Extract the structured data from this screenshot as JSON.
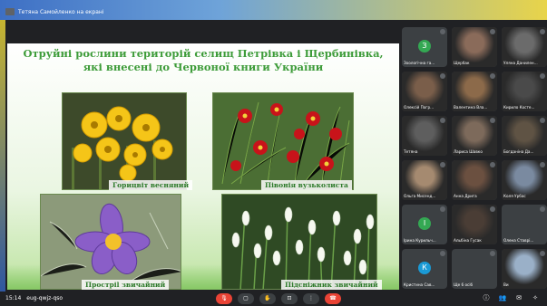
{
  "presenter": {
    "label": "Тетяна Самойленко на екрані"
  },
  "slide": {
    "title_line1": "Отруйні рослини територій селищ Петрівка і Щербинівка,",
    "title_line2": "які внесені до Червоної книги України",
    "photos": [
      {
        "caption": "Горицвіт весняний",
        "icon": "adonis-flower-photo"
      },
      {
        "caption": "Півонія вузьколиста",
        "icon": "peony-flower-photo"
      },
      {
        "caption": "Прострil звичайний",
        "icon": "pasqueflower-photo"
      },
      {
        "caption": "Підсніжник звичайний",
        "icon": "snowdrop-photo"
      }
    ]
  },
  "participants": [
    {
      "name": "Зоологічна га...",
      "initial": "З",
      "color": "#34a853",
      "video": false
    },
    {
      "name": "Щербак",
      "initial": "",
      "color": "#8a6b5a",
      "video": true
    },
    {
      "name": "Уляна Данилен...",
      "initial": "",
      "color": "#6b6b6b",
      "video": true
    },
    {
      "name": "Олексій Погр...",
      "initial": "",
      "color": "#7a5e4a",
      "video": true
    },
    {
      "name": "Валентина Вла...",
      "initial": "",
      "color": "#8c6a4a",
      "video": true
    },
    {
      "name": "Кирило Косте...",
      "initial": "",
      "color": "#4a4a4a",
      "video": true
    },
    {
      "name": "Тетяна",
      "initial": "",
      "color": "#5e5e5e",
      "video": true
    },
    {
      "name": "Лариса Шавко",
      "initial": "",
      "color": "#7d6a5b",
      "video": true
    },
    {
      "name": "Богданіна Да...",
      "initial": "",
      "color": "#5f5344",
      "video": true
    },
    {
      "name": "Ольга Мисенд...",
      "initial": "",
      "color": "#a58a70",
      "video": true
    },
    {
      "name": "Анна Дрига",
      "initial": "",
      "color": "#6b5040",
      "video": true
    },
    {
      "name": "Коля Урбас",
      "initial": "",
      "color": "#7a8aa0",
      "video": true
    },
    {
      "name": "Ірина Курильч...",
      "initial": "І",
      "color": "#34a853",
      "video": false
    },
    {
      "name": "Альбіна Гусак",
      "initial": "",
      "color": "#4a3d35",
      "video": true
    },
    {
      "name": "Олена Ставрі...",
      "initial": "",
      "color": "#3c4043",
      "video": false
    },
    {
      "name": "Кристина Сав...",
      "initial": "К",
      "color": "#1a9ad6",
      "video": false
    },
    {
      "name": "Ще 6 осіб",
      "initial": "",
      "color": "#3c4043",
      "video": false
    },
    {
      "name": "Ви",
      "initial": "",
      "color": "#9ab0c8",
      "video": true
    }
  ],
  "bottom": {
    "time": "15:14",
    "meeting_code": "eug-qwjz-qso"
  }
}
